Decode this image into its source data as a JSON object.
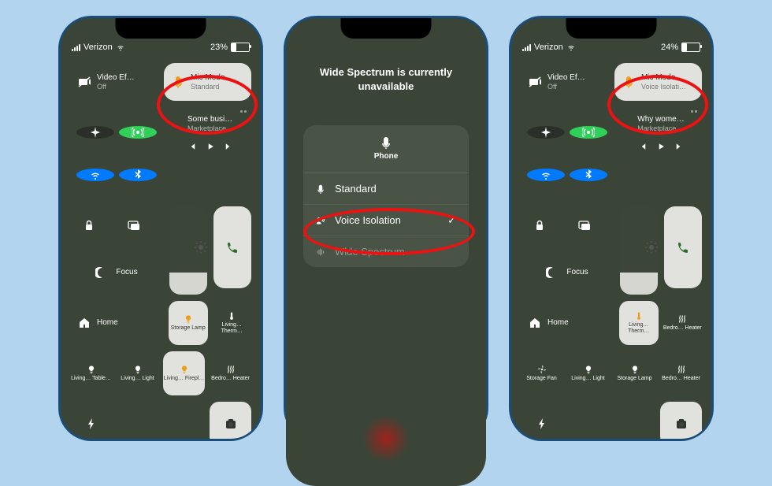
{
  "phone1": {
    "app": "Phone",
    "carrier": "Verizon",
    "battery": "23%",
    "videofx": {
      "title": "Video Ef…",
      "sub": "Off"
    },
    "micmode": {
      "title": "Mic Mode",
      "sub": "Standard"
    },
    "media": {
      "title": "Some busi…",
      "sub": "Marketplace…"
    },
    "focus": "Focus",
    "home": "Home",
    "hk": [
      {
        "l": "Storage Lamp"
      },
      {
        "l": "Living… Therm…"
      },
      {
        "l": "Living… Table…"
      },
      {
        "l": "Living… Light"
      },
      {
        "l": "Living… Firepl…"
      },
      {
        "l": "Bedro… Heater"
      }
    ]
  },
  "phone2": {
    "banner": "Wide Spectrum is currently unavailable",
    "app": "Phone",
    "items": [
      {
        "l": "Standard"
      },
      {
        "l": "Voice Isolation",
        "c": true
      },
      {
        "l": "Wide Spectrum"
      }
    ]
  },
  "phone3": {
    "app": "Phone",
    "carrier": "Verizon",
    "battery": "24%",
    "videofx": {
      "title": "Video Ef…",
      "sub": "Off"
    },
    "micmode": {
      "title": "Mic Mode",
      "sub": "Voice Isolati…"
    },
    "media": {
      "title": "Why wome…",
      "sub": "Marketplace…"
    },
    "focus": "Focus",
    "home": "Home",
    "hk": [
      {
        "l": "Living… Therm…"
      },
      {
        "l": "Bedro… Heater"
      },
      {
        "l": "Storage Fan"
      },
      {
        "l": "Living… Light"
      },
      {
        "l": "Storage Lamp"
      },
      {
        "l": "Bedro… Heater"
      }
    ]
  }
}
